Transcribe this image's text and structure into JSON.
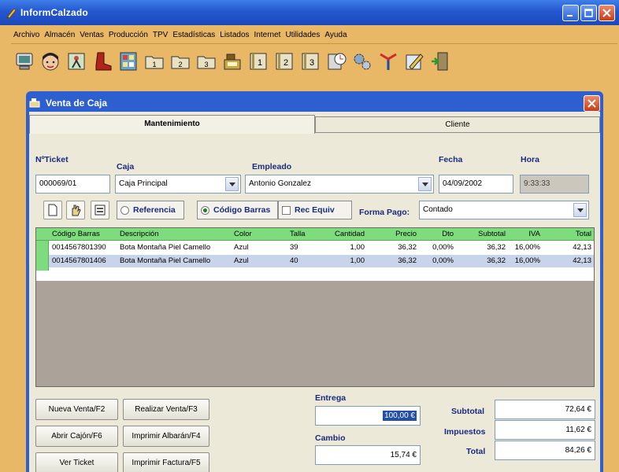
{
  "app": {
    "title": "InformCalzado"
  },
  "menubar": {
    "items": [
      "Archivo",
      "Almacén",
      "Ventas",
      "Producción",
      "TPV",
      "Estadísticas",
      "Listados",
      "Internet",
      "Utilidades",
      "Ayuda"
    ]
  },
  "toolbar": {
    "icons": [
      "computer-icon",
      "customer-face-icon",
      "worker-icon",
      "boot-icon",
      "calculator-grid-icon",
      "folder-1-icon",
      "folder-2-icon",
      "folder-3-icon",
      "cash-register-icon",
      "book-1-icon",
      "book-2-icon",
      "book-3-icon",
      "calculator-clock-icon",
      "gears-icon",
      "antenna-icon",
      "edit-pencil-icon",
      "exit-door-icon"
    ]
  },
  "dialog": {
    "title": "Venta de Caja",
    "tabs": [
      "Mantenimiento",
      "Cliente"
    ],
    "labels": {
      "ticket": "NºTicket",
      "caja": "Caja",
      "empleado": "Empleado",
      "fecha": "Fecha",
      "hora": "Hora",
      "forma_pago": "Forma Pago:",
      "entrega": "Entrega",
      "cambio": "Cambio",
      "subtotal": "Subtotal",
      "impuestos": "Impuestos",
      "total": "Total"
    },
    "values": {
      "ticket": "000069/01",
      "caja": "Caja Principal",
      "empleado": "Antonio Gonzalez",
      "fecha": "04/09/2002",
      "hora": "9:33:33",
      "forma_pago": "Contado",
      "entrega": "100,00 €",
      "cambio": "15,74 €",
      "subtotal": "72,64 €",
      "impuestos": "11,62 €",
      "total": "84,26 €"
    },
    "search_modes": {
      "referencia": "Referencia",
      "codigo_barras": "Código Barras",
      "rec_equiv": "Rec Equiv",
      "selected": "codigo_barras"
    },
    "grid": {
      "columns": [
        "Código Barras",
        "Descripción",
        "Color",
        "Talla",
        "Cantidad",
        "Precio",
        "Dto",
        "Subtotal",
        "IVA",
        "Total"
      ],
      "rows": [
        [
          "0014567801390",
          "Bota Montaña Piel Camello",
          "Azul",
          "39",
          "1,00",
          "36,32",
          "0,00%",
          "36,32",
          "16,00%",
          "42,13"
        ],
        [
          "0014567801406",
          "Bota Montaña Piel Camello",
          "Azul",
          "40",
          "1,00",
          "36,32",
          "0,00%",
          "36,32",
          "16,00%",
          "42,13"
        ]
      ]
    },
    "buttons": {
      "nueva_venta": "Nueva Venta/F2",
      "realizar_venta": "Realizar Venta/F3",
      "abrir_cajon": "Abrir Cajón/F6",
      "imprimir_albaran": "Imprimir Albarán/F4",
      "ver_ticket": "Ver Ticket",
      "imprimir_factura": "Imprimir Factura/F5"
    }
  },
  "colors": {
    "titlebar": "#2457cf",
    "app_background": "#e9b866",
    "grid_header": "#7edc7e",
    "label_text": "#1a2a80"
  }
}
